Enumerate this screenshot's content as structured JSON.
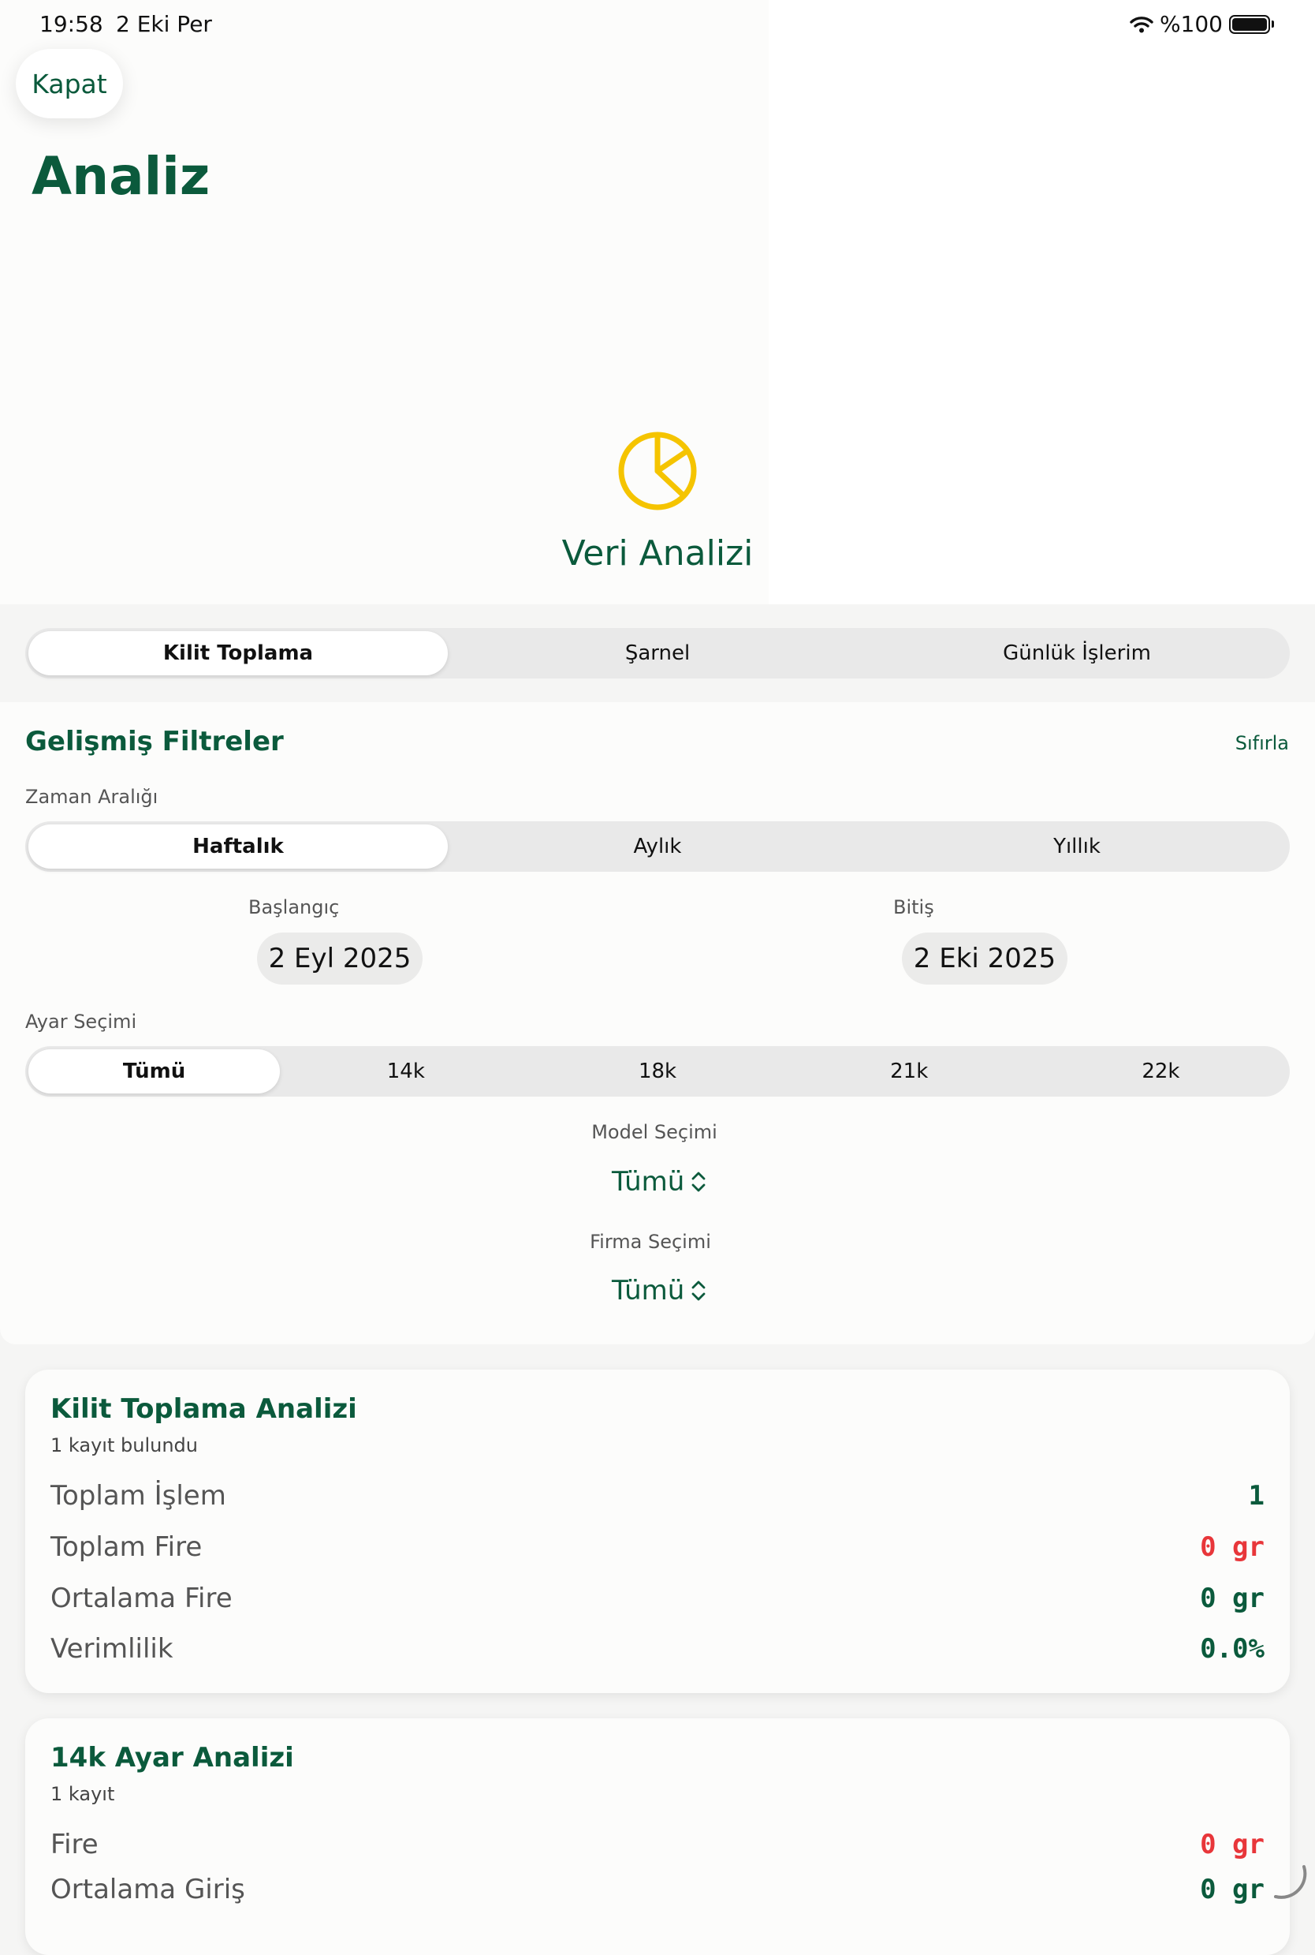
{
  "status": {
    "time": "19:58",
    "date": "2 Eki Per",
    "battery": "%100"
  },
  "nav": {
    "close_label": "Kapat",
    "title": "Analiz"
  },
  "hero": {
    "title": "Veri Analizi",
    "icon": "pie-chart-icon",
    "icon_color": "#f5c400"
  },
  "tabs": {
    "items": [
      "Kilit Toplama",
      "Şarnel",
      "Günlük İşlerim"
    ],
    "active": "Kilit Toplama"
  },
  "filters": {
    "title": "Gelişmiş Filtreler",
    "reset_label": "Sıfırla",
    "time_range_label": "Zaman Aralığı",
    "time_range": {
      "items": [
        "Haftalık",
        "Aylık",
        "Yıllık"
      ],
      "active": "Haftalık"
    },
    "start_label": "Başlangıç",
    "start_value": "2 Eyl 2025",
    "end_label": "Bitiş",
    "end_value": "2 Eki 2025",
    "karat_label": "Ayar Seçimi",
    "karat": {
      "items": [
        "Tümü",
        "14k",
        "18k",
        "21k",
        "22k"
      ],
      "active": "Tümü"
    },
    "model_label": "Model Seçimi",
    "model_value": "Tümü",
    "company_label": "Firma Seçimi",
    "company_value": "Tümü"
  },
  "summary_card": {
    "title": "Kilit Toplama Analizi",
    "subtitle": "1 kayıt bulundu",
    "rows": [
      {
        "label": "Toplam İşlem",
        "value": "1"
      },
      {
        "label": "Toplam Fire",
        "value": "0 gr"
      },
      {
        "label": "Ortalama Fire",
        "value": "0 gr"
      },
      {
        "label": "Verimlilik",
        "value": "0.0%"
      }
    ]
  },
  "karat_card": {
    "title": "14k Ayar Analizi",
    "subtitle": "1 kayıt",
    "rows": [
      {
        "label": "Fire",
        "value": "0 gr"
      },
      {
        "label": "Ortalama Giriş",
        "value": "0 gr"
      }
    ]
  },
  "colors": {
    "brand_green": "#0b5a3c",
    "alert_red": "#e8363a",
    "accent_yellow": "#f5c400"
  }
}
